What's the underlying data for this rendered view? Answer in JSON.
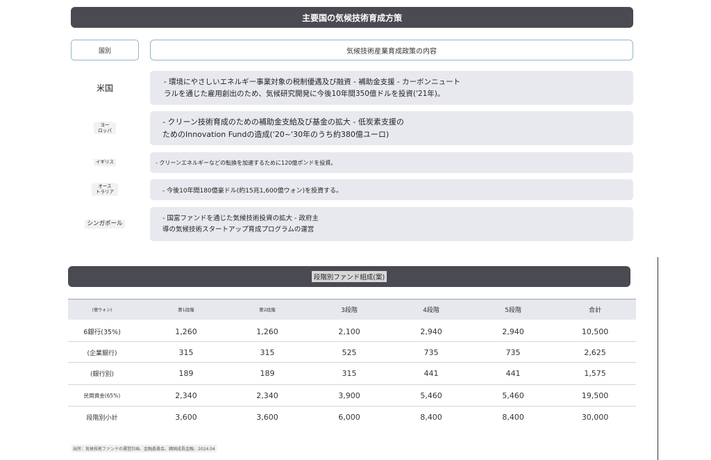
{
  "policy": {
    "title": "主要国の気候技術育成方策",
    "header_country": "国別",
    "header_content": "気候技術産業育成政策の内容",
    "rows": [
      {
        "country": "米国",
        "content_line1": "- 環境にやさしいエネルギー事業対象の税制優遇及び融資 - 補助金支援 - カーボンニュート",
        "content_line2": "ラルを通じた雇用創出のため、気候研究開発に今後10年間350億ドルを投資('21年)。"
      },
      {
        "country_line1": "ヨー",
        "country_line2": "ロッパ",
        "content_line1": "- クリーン技術育成のための補助金支給及び基金の拡大 - 低炭素支援の",
        "content_line2": "ためのInnovation Fundの造成('20~'30年のうち約380億ユーロ)"
      },
      {
        "country": "イギリス",
        "content_line1": "- クリーンエネルギーなどの転換を加速するために120億ポンドを投資。"
      },
      {
        "country_line1": "オース",
        "country_line2": "トラリア",
        "content_line1": "- 今後10年間180億豪ドル(約15兆1,600億ウォン)を投資する。"
      },
      {
        "country": "シンガポール",
        "content_line1": "- 国富ファンドを通じた気候技術投資の拡大 - 政府主",
        "content_line2": "導の気候技術スタートアップ育成プログラムの運営"
      }
    ]
  },
  "fund_table": {
    "title": "段階別ファンド組成(案)",
    "columns": [
      "(億ウォン)",
      "第1段階",
      "第2段階",
      "3段階",
      "4段階",
      "5段階",
      "合計"
    ],
    "rows": [
      {
        "label": "6銀行(35%)",
        "values": [
          "1,260",
          "1,260",
          "2,100",
          "2,940",
          "2,940",
          "10,500"
        ]
      },
      {
        "label": "(企業銀行)",
        "values": [
          "315",
          "315",
          "525",
          "735",
          "735",
          "2,625"
        ]
      },
      {
        "label": "(銀行別)",
        "values": [
          "189",
          "189",
          "315",
          "441",
          "441",
          "1,575"
        ]
      },
      {
        "label": "民間資金(65%)",
        "values": [
          "2,340",
          "2,340",
          "3,900",
          "5,460",
          "5,460",
          "19,500"
        ]
      },
      {
        "label": "段階別小計",
        "values": [
          "3,600",
          "3,600",
          "6,000",
          "8,400",
          "8,400",
          "30,000"
        ]
      }
    ],
    "source": "出所：気候技術ファンドの運営計画、金融委員会、韓国成長金融、2024.04"
  }
}
